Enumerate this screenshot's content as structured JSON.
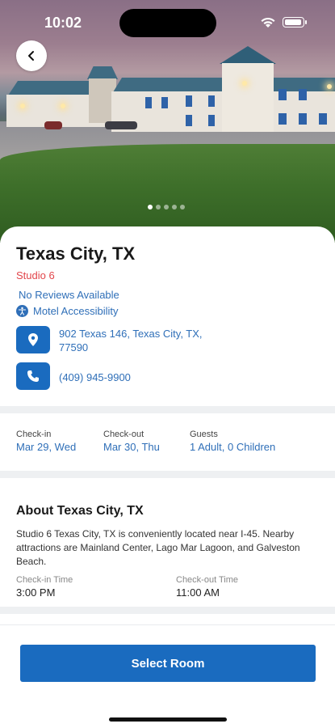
{
  "status": {
    "time": "10:02"
  },
  "gallery": {
    "total_dots": 5,
    "active_index": 0
  },
  "hotel": {
    "title": "Texas City, TX",
    "brand": "Studio 6",
    "reviews": "No Reviews Available",
    "accessibility_label": "Motel Accessibility",
    "address": "902 Texas 146, Texas City, TX, 77590",
    "phone": "(409) 945-9900"
  },
  "stay": {
    "checkin_label": "Check-in",
    "checkin_value": "Mar 29, Wed",
    "checkout_label": "Check-out",
    "checkout_value": "Mar 30, Thu",
    "guests_label": "Guests",
    "guests_value": "1 Adult, 0 Children"
  },
  "about": {
    "title": "About Texas City, TX",
    "text": "Studio 6 Texas City, TX is conveniently located near I-45. Nearby attractions are Mainland Center, Lago Mar Lagoon, and Galveston Beach.",
    "checkin_time_label": "Check-in Time",
    "checkin_time_value": "3:00 PM",
    "checkout_time_label": "Check-out Time",
    "checkout_time_value": "11:00 AM"
  },
  "actions": {
    "select_room": "Select Room"
  },
  "colors": {
    "accent": "#1a6bbf",
    "link": "#2f6fb8",
    "brand": "#e2454a"
  },
  "icons": {
    "back": "chevron-left-icon",
    "location": "map-pin-icon",
    "phone": "phone-icon",
    "accessibility": "accessibility-icon"
  }
}
